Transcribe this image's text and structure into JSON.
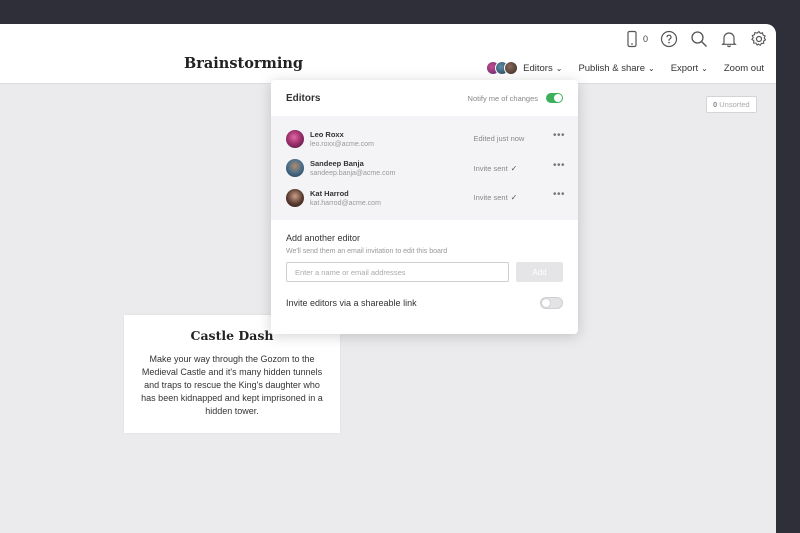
{
  "board": {
    "title": "Brainstorming"
  },
  "topbar": {
    "device_count": "0",
    "icons": [
      "phone-icon",
      "help-icon",
      "search-icon",
      "bell-icon",
      "gear-icon"
    ],
    "menu": {
      "editors_label": "Editors",
      "publish_label": "Publish & share",
      "export_label": "Export",
      "zoom_label": "Zoom out"
    }
  },
  "unsorted": {
    "count": "0",
    "label": "Unsorted"
  },
  "card": {
    "title": "Castle Dash",
    "body": "Make your way through the Gozom to the Medieval Castle and it's many hidden tunnels and traps to rescue the King's daughter who has been kidnapped and kept imprisoned in a hidden tower."
  },
  "panel": {
    "title": "Editors",
    "notify_label": "Notify me of changes",
    "notify_on": true,
    "editors": [
      {
        "name": "Leo Roxx",
        "email": "leo.roxx@acme.com",
        "status": "Edited just now",
        "checked": false
      },
      {
        "name": "Sandeep Banja",
        "email": "sandeep.banja@acme.com",
        "status": "Invite sent",
        "checked": true
      },
      {
        "name": "Kat Harrod",
        "email": "kat.harrod@acme.com",
        "status": "Invite sent",
        "checked": true
      }
    ],
    "add": {
      "title": "Add another editor",
      "subtitle": "We'll send them an email invitation to edit this board",
      "placeholder": "Enter a name or email addresses",
      "button": "Add"
    },
    "share_label": "Invite editors via a shareable link",
    "share_on": false
  },
  "colors": {
    "toggle_on": "#3cb05a",
    "frame": "#2f2f3a",
    "canvas": "#ebebed"
  }
}
